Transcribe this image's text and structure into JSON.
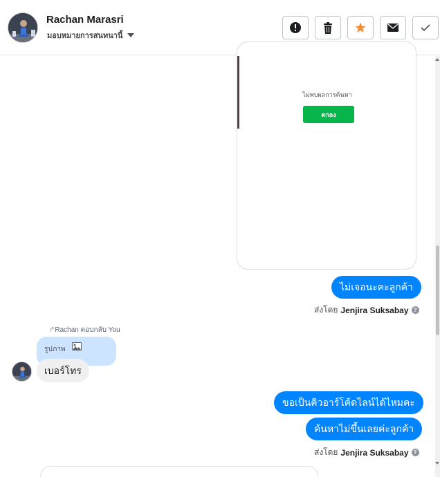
{
  "header": {
    "contact_name": "Rachan Marasri",
    "assign_label": "มอบหมายการสนทนานี้",
    "actions": [
      {
        "name": "spam-button",
        "icon": "alert-icon"
      },
      {
        "name": "delete-button",
        "icon": "trash-icon"
      },
      {
        "name": "star-button",
        "icon": "star-icon"
      },
      {
        "name": "mark-unread-button",
        "icon": "envelope-icon"
      },
      {
        "name": "done-button",
        "icon": "check-icon"
      }
    ]
  },
  "attachment": {
    "text": "ไม่พบผลการค้นหา",
    "button": "ตกลง"
  },
  "messages": {
    "out_1": "ไม่เจอนะคะลูกค้า",
    "sent_by_prefix": "ส่งโดย",
    "sent_by_name": "Jenjira Suksabay",
    "reply_note": "Rachan ตอบกลับ You",
    "reply_quote": "รูปภาพ",
    "in_1": "เบอร์โทร",
    "out_2": "ขอเป็นคิวอาร์โค้ดไลน์ได้ไหมคะ",
    "out_3": "ค้นหาไม่ขึ้นเลยค่ะลูกค้า"
  },
  "colors": {
    "accent": "#0084ff",
    "star": "#f0923c",
    "line_green": "#06b64b",
    "reply_bg": "#cce4ff"
  }
}
